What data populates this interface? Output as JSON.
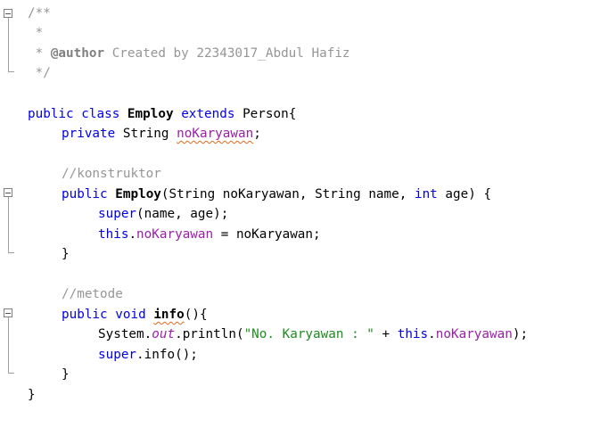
{
  "editor": {
    "lines": {
      "l1": "/**",
      "l2": " *",
      "l3_star": " * ",
      "l3_tag": "@author",
      "l3_rest": " Created by 22343017_Abdul Hafiz",
      "l4": " */",
      "l6_kw1": "public",
      "l6_kw2": "class",
      "l6_name": "Employ",
      "l6_kw3": "extends",
      "l6_rest": "Person{",
      "l7_kw": "private",
      "l7_type": "String",
      "l7_field": "noKaryawan",
      "l7_end": ";",
      "l9": "//konstruktor",
      "l10_kw": "public",
      "l10_name": "Employ",
      "l10_a": "(String noKaryawan, String name, ",
      "l10_int": "int",
      "l10_b": " age) {",
      "l11_kw": "super",
      "l11_rest": "(name, age);",
      "l12_this": "this",
      "l12_dot": ".",
      "l12_field": "noKaryawan",
      "l12_rest": " = noKaryawan;",
      "l13": "}",
      "l15": "//metode",
      "l16_kw1": "public",
      "l16_kw2": "void",
      "l16_name": "info",
      "l16_rest": "(){",
      "l17_a": "System.",
      "l17_out": "out",
      "l17_b": ".println(",
      "l17_str": "\"No. Karyawan : \"",
      "l17_c": " + ",
      "l17_this": "this",
      "l17_dot": ".",
      "l17_field": "noKaryawan",
      "l17_end": ");",
      "l18_kw": "super",
      "l18_rest": ".info();",
      "l19": "}",
      "l20": "}"
    },
    "colors": {
      "keyword": "#0000e6",
      "comment": "#969696",
      "field": "#9a20a8",
      "string": "#1f8c1f"
    }
  }
}
